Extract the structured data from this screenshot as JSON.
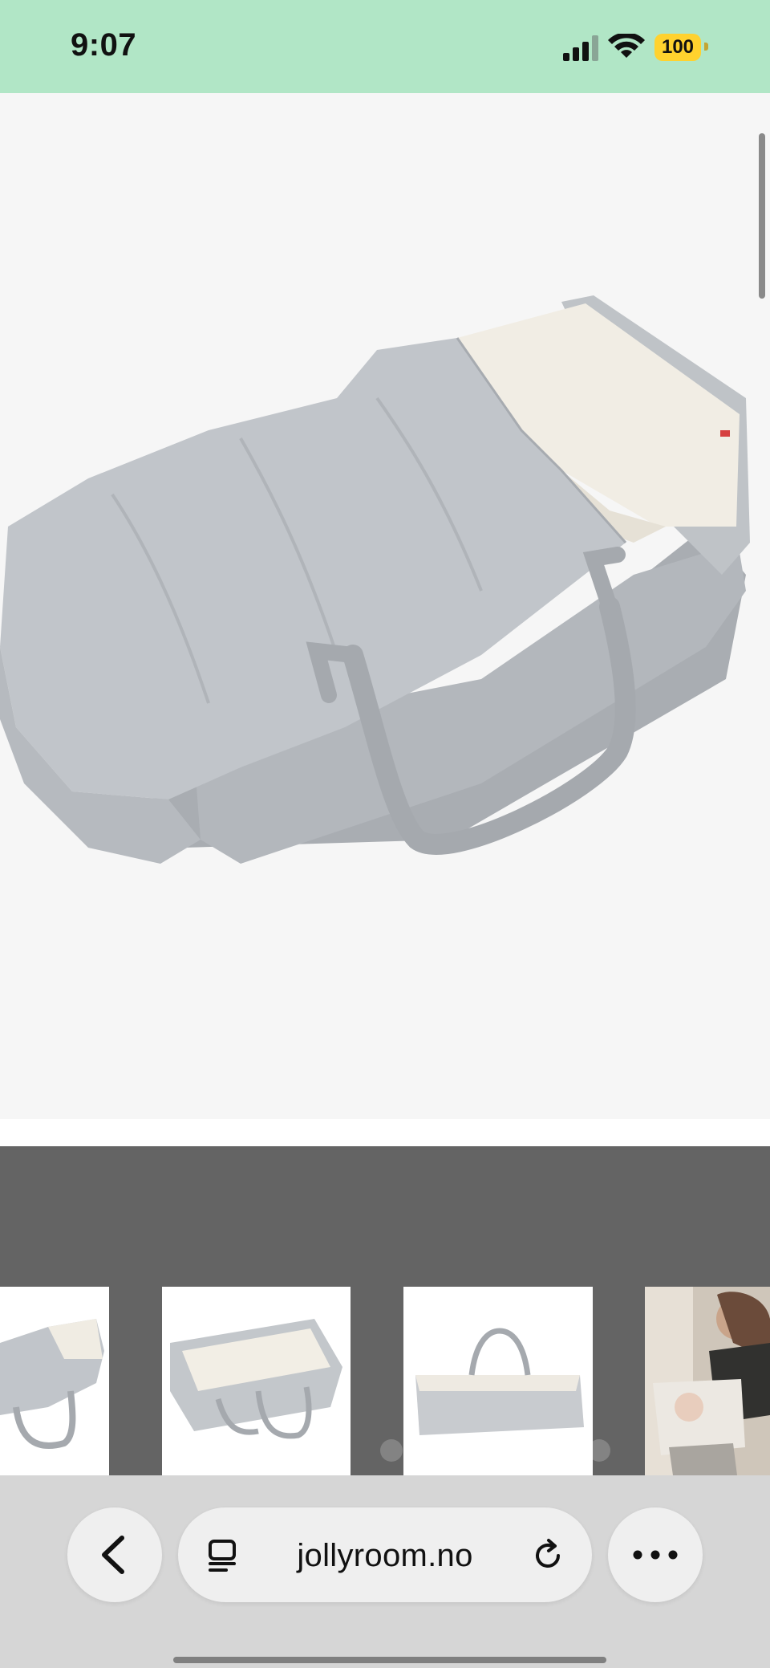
{
  "status_bar": {
    "time": "9:07",
    "battery_level": "100",
    "background_color": "#b1e6c6",
    "battery_color": "#ffd22e",
    "icons": [
      "signal-icon",
      "wifi-icon",
      "battery-icon"
    ]
  },
  "product_gallery": {
    "main_image_alt": "Grey baby carrycot with handles",
    "thumbnails": [
      {
        "alt": "Carrycot side view"
      },
      {
        "alt": "Carrycot open top view"
      },
      {
        "alt": "Carrycot with raised handles"
      },
      {
        "alt": "Mother with baby in carrycot"
      }
    ]
  },
  "toolbar": {
    "url": "jollyroom.no",
    "icons": [
      "back-icon",
      "reader-icon",
      "reload-icon",
      "more-icon"
    ]
  }
}
